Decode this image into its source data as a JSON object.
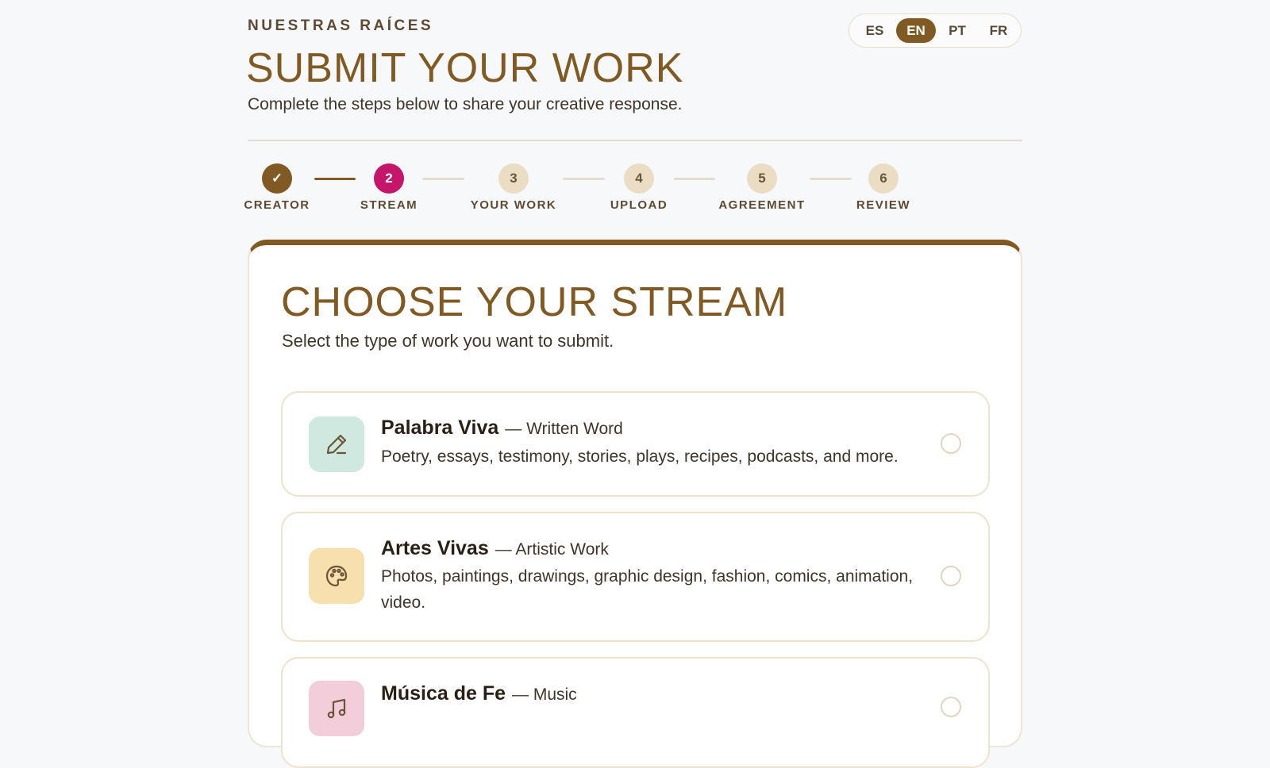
{
  "header": {
    "eyebrow": "NUESTRAS RAÍCES",
    "title": "SUBMIT YOUR WORK",
    "subtitle": "Complete the steps below to share your creative response."
  },
  "languages": [
    {
      "code": "ES",
      "active": false
    },
    {
      "code": "EN",
      "active": true
    },
    {
      "code": "PT",
      "active": false
    },
    {
      "code": "FR",
      "active": false
    }
  ],
  "steps": [
    {
      "marker": "✓",
      "label": "CREATOR",
      "state": "done"
    },
    {
      "marker": "2",
      "label": "STREAM",
      "state": "current"
    },
    {
      "marker": "3",
      "label": "YOUR WORK",
      "state": "upcoming"
    },
    {
      "marker": "4",
      "label": "UPLOAD",
      "state": "upcoming"
    },
    {
      "marker": "5",
      "label": "AGREEMENT",
      "state": "upcoming"
    },
    {
      "marker": "6",
      "label": "REVIEW",
      "state": "upcoming"
    }
  ],
  "card": {
    "title": "CHOOSE YOUR STREAM",
    "subtitle": "Select the type of work you want to submit."
  },
  "streams": [
    {
      "name": "Palabra Viva",
      "tag": "— Written Word",
      "description": "Poetry, essays, testimony, stories, plays, recipes, podcasts, and more.",
      "icon": "pencil-icon",
      "icon_bg": "#cfe9e0",
      "selected": false
    },
    {
      "name": "Artes Vivas",
      "tag": "— Artistic Work",
      "description": "Photos, paintings, drawings, graphic design, fashion, comics, animation, video.",
      "icon": "palette-icon",
      "icon_bg": "#f7dfae",
      "selected": false
    },
    {
      "name": "Música de Fe",
      "tag": "— Music",
      "description": "",
      "icon": "music-note-icon",
      "icon_bg": "#f4cddb",
      "selected": false
    }
  ],
  "colors": {
    "brand": "#805a22",
    "accent": "#c5166c",
    "step_upcoming": "#ebdcc4"
  }
}
